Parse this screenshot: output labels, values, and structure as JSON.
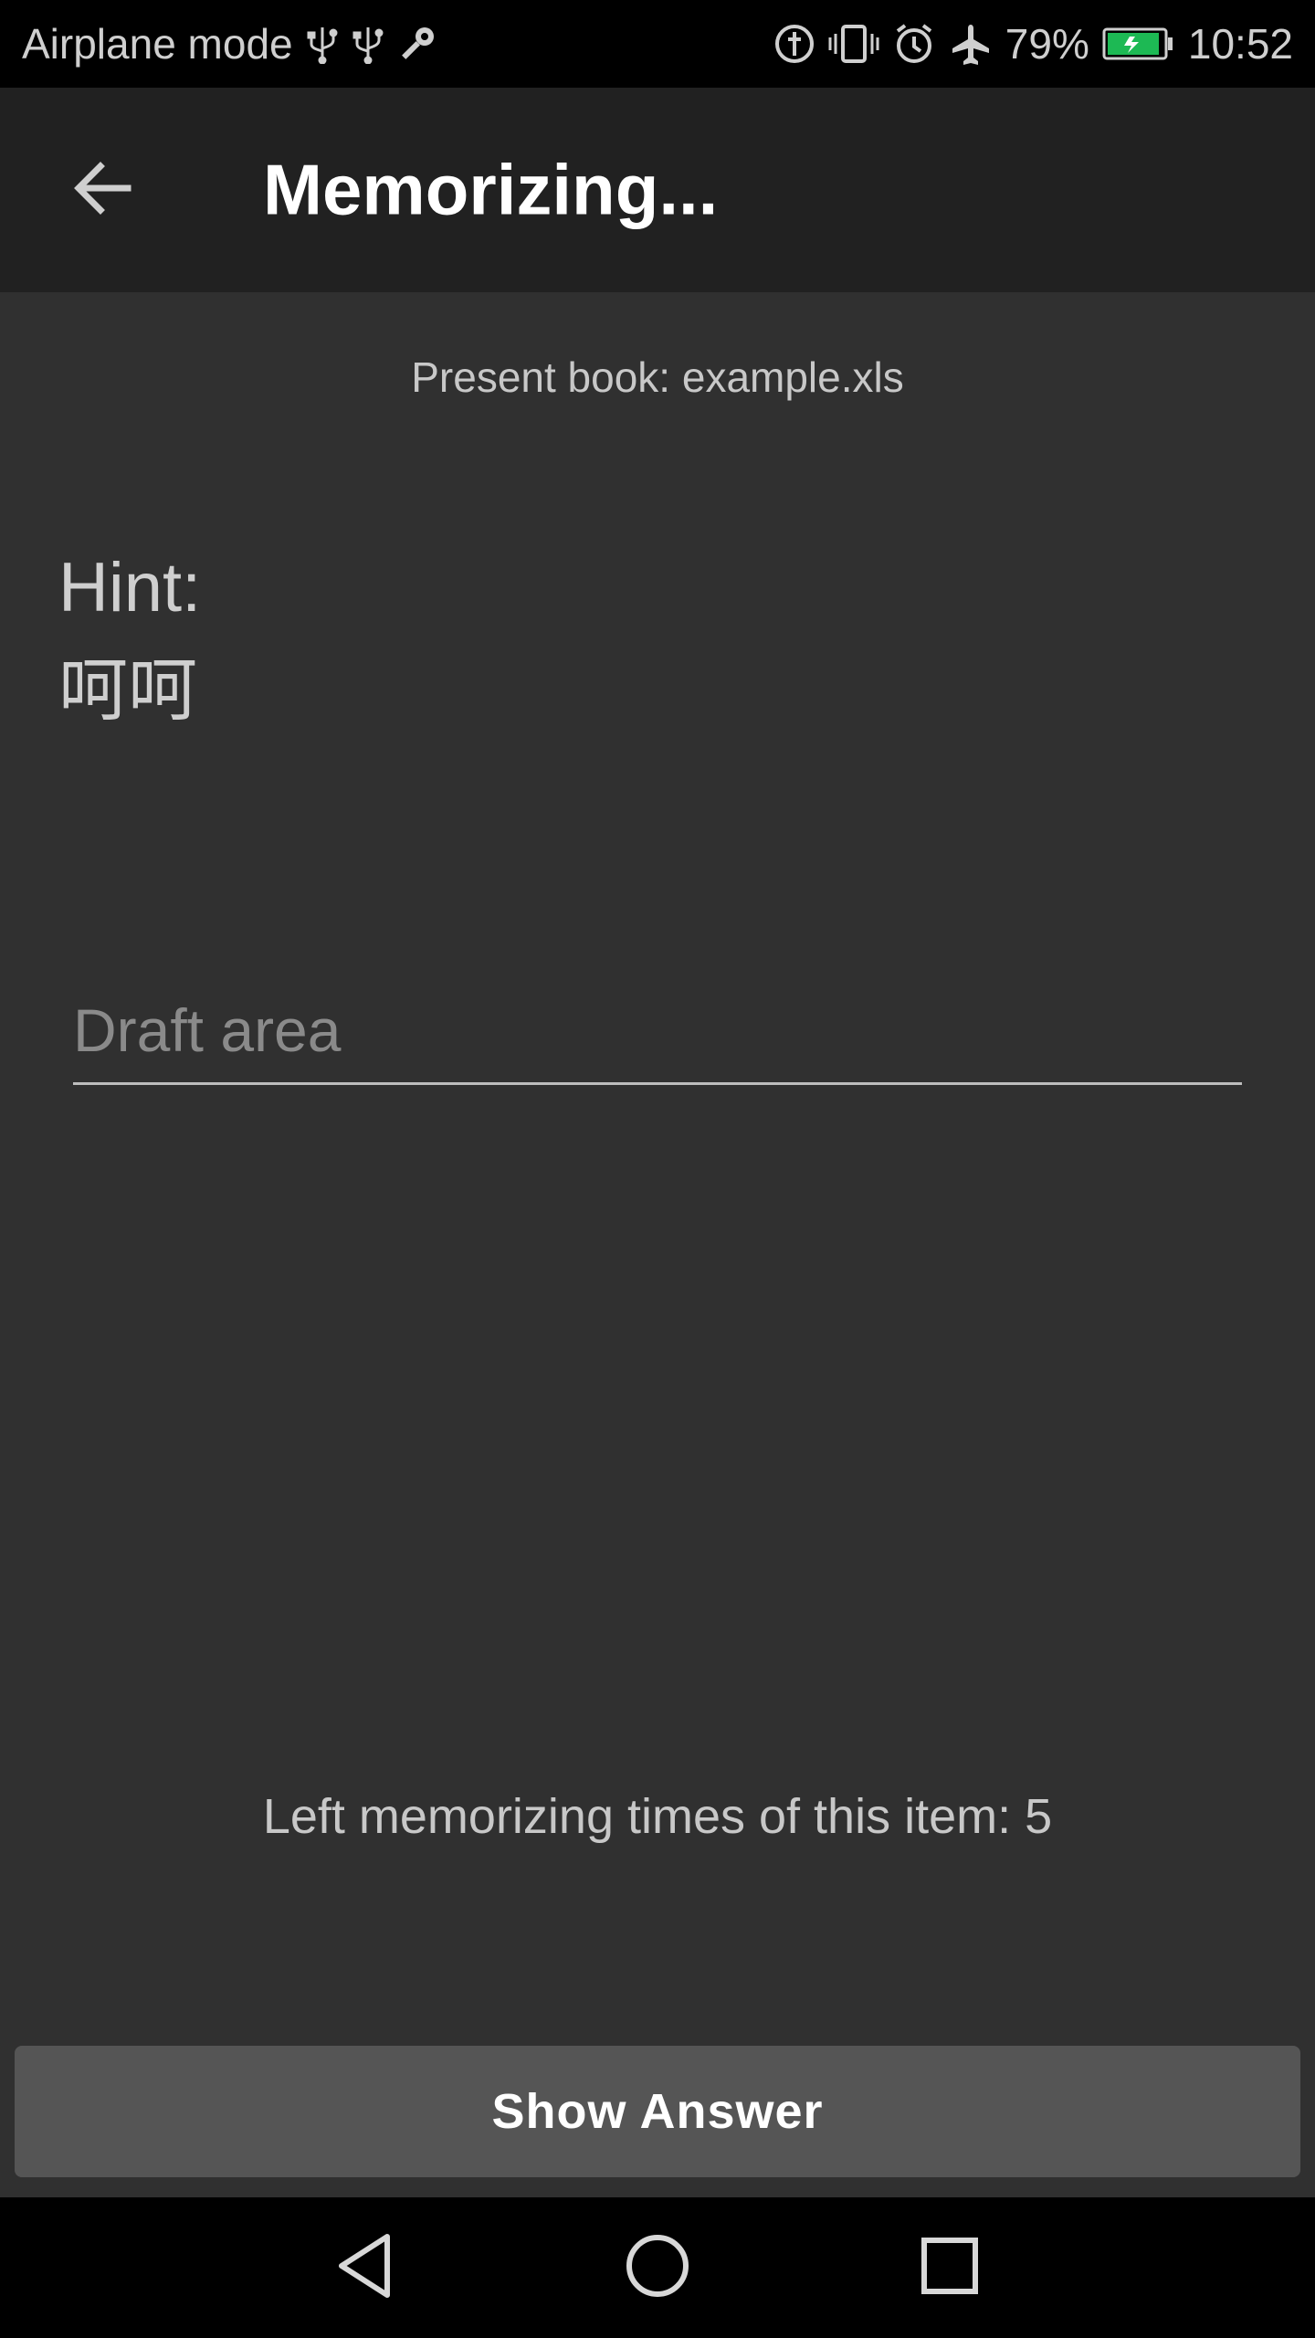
{
  "status_bar": {
    "left_text": "Airplane mode",
    "battery_percent": "79%",
    "time": "10:52",
    "icons_left": [
      "usb-icon",
      "usb-icon",
      "key-icon"
    ],
    "icons_right": [
      "data-saver-icon",
      "vibrate-icon",
      "alarm-icon",
      "airplane-icon",
      "battery-charging-icon"
    ],
    "battery_color": "#1db954"
  },
  "app_bar": {
    "title": "Memorizing...",
    "back_icon": "arrow-back-icon"
  },
  "main": {
    "present_book": "Present book: example.xls",
    "hint_label": "Hint:",
    "hint_value": "呵呵",
    "draft_placeholder": "Draft area",
    "draft_value": "",
    "left_times_text": "Left memorizing times of this item: 5"
  },
  "actions": {
    "show_answer_label": "Show Answer"
  },
  "nav_bar": {
    "icons": [
      "back-triangle-icon",
      "home-circle-icon",
      "recents-square-icon"
    ]
  }
}
